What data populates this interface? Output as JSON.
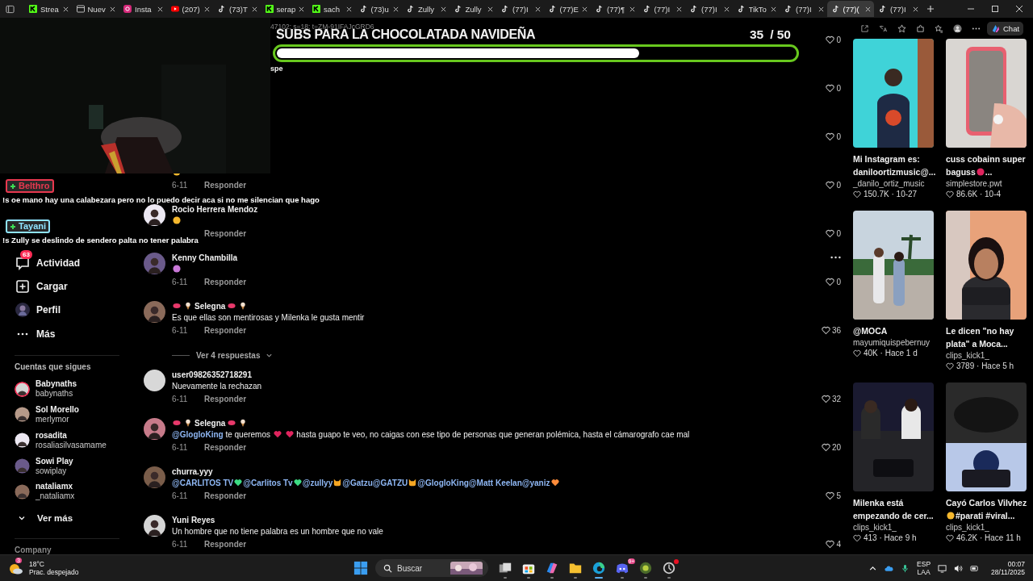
{
  "browser": {
    "tabs": [
      {
        "title": "Strea",
        "selected": false
      },
      {
        "title": "Nuev",
        "selected": false
      },
      {
        "title": "Insta",
        "selected": false
      },
      {
        "title": "(207)",
        "selected": false
      },
      {
        "title": "(73)T",
        "selected": false
      },
      {
        "title": "serap",
        "selected": false
      },
      {
        "title": "sach",
        "selected": false
      },
      {
        "title": "(73)u",
        "selected": false
      },
      {
        "title": "Zully",
        "selected": false
      },
      {
        "title": "Zully",
        "selected": false
      },
      {
        "title": "(77)I",
        "selected": false
      },
      {
        "title": "(77)E",
        "selected": false
      },
      {
        "title": "(77)¶",
        "selected": false
      },
      {
        "title": "(77)I",
        "selected": false
      },
      {
        "title": "(77)I",
        "selected": false
      },
      {
        "title": "TikTo",
        "selected": false
      },
      {
        "title": "(77)I",
        "selected": false
      },
      {
        "title": "(77)(",
        "selected": true
      },
      {
        "title": "(77)I",
        "selected": false
      }
    ],
    "url_fragment": "47102; s=18; t=ZM-91IFAJcGRD6",
    "chat_label": "Chat"
  },
  "stream_overlay": {
    "goal_title": "SUBS PARA LA CHOCOLATADA NAVIDEÑA",
    "goal_current": "35",
    "goal_target": "/ 50",
    "level": 0.7,
    "note": "spe"
  },
  "chat_overlay": [
    {
      "user": "Belthro",
      "color": "#e8384f",
      "text": "!s oe mano hay una calabezara pero no lo puedo decir aca si no me silencian que hago"
    },
    {
      "user": "Tayani",
      "color": "#8fe3ff",
      "text": "!s Zully se deslindo de sendero palta no tener palabra"
    }
  ],
  "sidebar": {
    "nav": [
      {
        "label": "Actividad",
        "badge": "63"
      },
      {
        "label": "Cargar"
      },
      {
        "label": "Perfil"
      },
      {
        "label": "Más"
      }
    ],
    "following_title": "Cuentas que sigues",
    "following": [
      {
        "name": "Babynaths",
        "handle": "babynaths",
        "live": true
      },
      {
        "name": "Sol Morello",
        "handle": "merlymor",
        "live": false
      },
      {
        "name": "rosadita",
        "handle": "rosaliasilvasamame",
        "live": false
      },
      {
        "name": "Sowi Play",
        "handle": "sowiplay",
        "live": false
      },
      {
        "name": "nataliamx",
        "handle": "_nataliamx",
        "live": false
      }
    ],
    "see_more": "Ver más",
    "footer": "Company"
  },
  "comments": [
    {
      "likes": "0"
    },
    {
      "likes": "0"
    },
    {
      "likes": "0"
    },
    {
      "body": [
        {
          "kind": "face",
          "color": "#f5b82e"
        }
      ],
      "date": "6-11",
      "reply": "Responder",
      "likes": "0"
    },
    {
      "name": "Rocio Herrera Mendoz",
      "body": [
        {
          "kind": "face",
          "color": "#f5b82e"
        }
      ],
      "reply": "Responder",
      "likes": "0"
    },
    {
      "name": "Kenny Chambilla",
      "body": [
        {
          "kind": "face",
          "color": "#c978d8"
        }
      ],
      "date": "6-11",
      "reply": "Responder",
      "likes": "0",
      "more": true
    },
    {
      "name": "Selegna",
      "decorated": true,
      "body": [
        {
          "kind": "text",
          "text": "Es que ellas son mentirosas y Milenka le gusta mentir"
        }
      ],
      "date": "6-11",
      "reply": "Responder",
      "likes": "36",
      "replies": "Ver 4 respuestas"
    },
    {
      "name": "user09826352718291",
      "body": [
        {
          "kind": "text",
          "text": "Nuevamente la rechazan"
        }
      ],
      "date": "6-11",
      "reply": "Responder",
      "likes": "32"
    },
    {
      "name": "Selegna",
      "decorated": true,
      "body": [
        {
          "kind": "mention",
          "text": "@GlogloKing"
        },
        {
          "kind": "text",
          "text": "te queremos"
        },
        {
          "kind": "heart",
          "color": "#e0245e"
        },
        {
          "kind": "heart",
          "color": "#e0245e"
        },
        {
          "kind": "text",
          "text": "hasta guapo te veo, no caigas con ese tipo de personas que generan polémica, hasta el cámarografo cae mal"
        }
      ],
      "date": "6-11",
      "reply": "Responder",
      "likes": "20"
    },
    {
      "name": "churra.yyy",
      "body": [
        {
          "kind": "mention",
          "text": "@CARLITOS TV"
        },
        {
          "kind": "heart",
          "color": "#3ddc84"
        },
        {
          "kind": "mention",
          "text": "@Carlitos Tv"
        },
        {
          "kind": "heart",
          "color": "#3ddc84"
        },
        {
          "kind": "mention",
          "text": "@zullyy"
        },
        {
          "kind": "cat",
          "color": "#f5a623"
        },
        {
          "kind": "mention",
          "text": "@Gatzu"
        },
        {
          "kind": "mention",
          "text": "@GATZU"
        },
        {
          "kind": "cat",
          "color": "#f5a623"
        },
        {
          "kind": "mention",
          "text": "@GlogloKing"
        },
        {
          "kind": "mention",
          "text": "@Matt Keelan"
        },
        {
          "kind": "mention",
          "text": "@yaniz"
        },
        {
          "kind": "heart",
          "color": "#ff8c3a"
        }
      ],
      "date": "6-11",
      "reply": "Responder",
      "likes": "5"
    },
    {
      "name": "Yuni Reyes",
      "body": [
        {
          "kind": "text",
          "text": "Un hombre que no tiene palabra es un hombre que no vale"
        }
      ],
      "date": "6-11",
      "reply": "Responder",
      "likes": "4"
    }
  ],
  "videos": [
    {
      "lines": [
        [
          {
            "kind": "text",
            "text": "Mi Instagram es:"
          }
        ],
        [
          {
            "kind": "text",
            "text": "daniloortizmusic@..."
          }
        ]
      ],
      "author": "_danilo_ortiz_music",
      "stats": "150.7K · 10-27"
    },
    {
      "lines": [
        [
          {
            "kind": "text",
            "text": "cuss cobainn super"
          }
        ],
        [
          {
            "kind": "text",
            "text": "baguss"
          },
          {
            "kind": "face",
            "color": "#e0245e"
          },
          {
            "kind": "text",
            "text": "..."
          }
        ]
      ],
      "author": "simplestore.pwt",
      "stats": "86.6K · 10-4"
    },
    {
      "lines": [
        [
          {
            "kind": "text",
            "text": "@MOCA"
          }
        ]
      ],
      "author": "mayumiquispebernuy",
      "stats": "40K · Hace 1 d"
    },
    {
      "lines": [
        [
          {
            "kind": "text",
            "text": "Le dicen \"no hay"
          }
        ],
        [
          {
            "kind": "text",
            "text": "plata\" a Moca..."
          }
        ]
      ],
      "author": "clips_kick1_",
      "stats": "3789 · Hace 5 h"
    },
    {
      "lines": [
        [
          {
            "kind": "text",
            "text": "Milenka está"
          }
        ],
        [
          {
            "kind": "text",
            "text": "empezando de cer..."
          }
        ]
      ],
      "author": "clips_kick1_",
      "stats": "413 · Hace 9 h"
    },
    {
      "lines": [
        [
          {
            "kind": "text",
            "text": "Cayó Carlos Vilvhez"
          }
        ],
        [
          {
            "kind": "face",
            "color": "#f5b82e"
          },
          {
            "kind": "text",
            "text": "#parati #viral..."
          }
        ]
      ],
      "author": "clips_kick1_",
      "stats": "46.2K · Hace 11 h"
    }
  ],
  "taskbar": {
    "weather": {
      "temp": "18°C",
      "desc": "Prac. despejado",
      "badge": "3"
    },
    "search": {
      "placeholder": "Buscar"
    },
    "apps": [
      {
        "active": false
      },
      {
        "active": false
      },
      {
        "active": false
      },
      {
        "active": false
      },
      {
        "active": true
      },
      {
        "active": false,
        "badge": "9+"
      },
      {
        "active": false
      },
      {
        "active": false,
        "notify": true
      }
    ],
    "tray": {
      "lang": "ESP",
      "layout": "LAA",
      "time": "00:07",
      "date": "28/11/2025"
    }
  }
}
